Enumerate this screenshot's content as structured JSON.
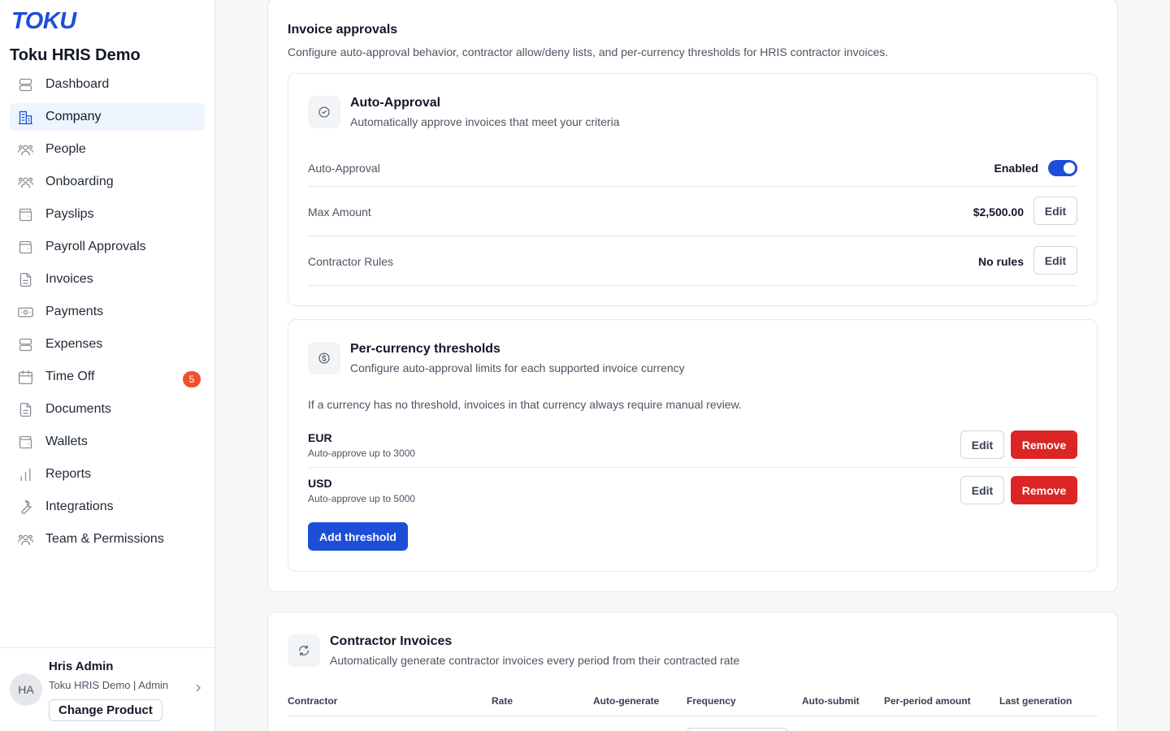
{
  "sidebar": {
    "logo": "TOKU",
    "org_name": "Toku HRIS Demo",
    "items": [
      {
        "label": "Dashboard",
        "icon": "dashboard-icon"
      },
      {
        "label": "Company",
        "icon": "building-icon",
        "active": true
      },
      {
        "label": "People",
        "icon": "users-icon"
      },
      {
        "label": "Onboarding",
        "icon": "users-icon"
      },
      {
        "label": "Payslips",
        "icon": "wallet-icon"
      },
      {
        "label": "Payroll Approvals",
        "icon": "wallet-icon"
      },
      {
        "label": "Invoices",
        "icon": "document-icon"
      },
      {
        "label": "Payments",
        "icon": "banknote-icon"
      },
      {
        "label": "Expenses",
        "icon": "dashboard-icon"
      },
      {
        "label": "Time Off",
        "icon": "calendar-icon",
        "badge": "5"
      },
      {
        "label": "Documents",
        "icon": "document-icon"
      },
      {
        "label": "Wallets",
        "icon": "wallet-icon"
      },
      {
        "label": "Reports",
        "icon": "bar-chart-icon"
      },
      {
        "label": "Integrations",
        "icon": "wrench-icon"
      },
      {
        "label": "Team & Permissions",
        "icon": "users-icon"
      }
    ],
    "user": {
      "initials": "HA",
      "name": "Hris Admin",
      "subtitle": "Toku HRIS Demo | Admin",
      "change_product_label": "Change Product"
    }
  },
  "invoice_approvals": {
    "title": "Invoice approvals",
    "description": "Configure auto-approval behavior, contractor allow/deny lists, and per-currency thresholds for HRIS contractor invoices.",
    "auto_approval": {
      "title": "Auto-Approval",
      "subtitle": "Automatically approve invoices that meet your criteria",
      "rows": {
        "auto_approval_label": "Auto-Approval",
        "auto_approval_value": "Enabled",
        "max_amount_label": "Max Amount",
        "max_amount_value": "$2,500.00",
        "contractor_rules_label": "Contractor Rules",
        "contractor_rules_value": "No rules"
      },
      "edit_label": "Edit",
      "toggle_on": true
    },
    "thresholds": {
      "title": "Per-currency thresholds",
      "subtitle": "Configure auto-approval limits for each supported invoice currency",
      "info": "If a currency has no threshold, invoices in that currency always require manual review.",
      "items": [
        {
          "code": "EUR",
          "desc": "Auto-approve up to 3000"
        },
        {
          "code": "USD",
          "desc": "Auto-approve up to 5000"
        }
      ],
      "edit_label": "Edit",
      "remove_label": "Remove",
      "add_label": "Add threshold"
    }
  },
  "contractor_invoices": {
    "title": "Contractor Invoices",
    "subtitle": "Automatically generate contractor invoices every period from their contracted rate",
    "columns": [
      "Contractor",
      "Rate",
      "Auto-generate",
      "Frequency",
      "Auto-submit",
      "Per-period amount",
      "Last generation"
    ]
  },
  "colors": {
    "accent": "#1d4ed8",
    "danger": "#dc2626",
    "badge": "#f0502e"
  }
}
